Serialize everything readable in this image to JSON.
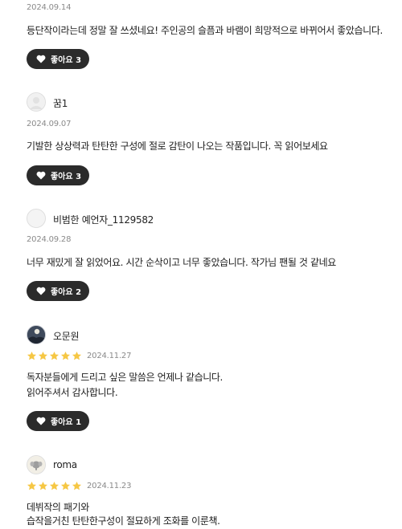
{
  "reviews": [
    {
      "user": "",
      "date": "2024.09.14",
      "lines": [
        "등단작이라는데 정말 잘 쓰셨네요! 주인공의 슬픔과 바램이 희망적으로 바뀌어서 좋았습니다."
      ],
      "like_label": "좋아요 3"
    },
    {
      "user": "꿈1",
      "date": "2024.09.07",
      "lines": [
        "기발한 상상력과 탄탄한 구성에 절로 감탄이 나오는 작품입니다. 꼭 읽어보세요"
      ],
      "like_label": "좋아요 3",
      "avatar_icon": "default-avatar-icon"
    },
    {
      "user": "비범한 예언자_1129582",
      "date": "2024.09.28",
      "lines": [
        "너무 재밌게 잘 읽었어요. 시간 순삭이고 너무 좋았습니다. 작가님 팬될 것 같네요"
      ],
      "like_label": "좋아요 2",
      "avatar_icon": "default-avatar-icon"
    },
    {
      "user": "오문원",
      "date": "2024.11.27",
      "rating": 5,
      "lines": [
        "독자분들에게 드리고 싶은 말씀은 언제나 같습니다.",
        "읽어주셔서 감사합니다."
      ],
      "like_label": "좋아요 1",
      "avatar_icon": "moon-landscape-avatar-icon"
    },
    {
      "user": "roma",
      "date": "2024.11.23",
      "rating": 5,
      "lines": [
        "데뷔작의  패기와",
        "습작을거친  탄탄한구성이  절묘하게  조화를 이룬책."
      ],
      "avatar_icon": "elephant-avatar-icon"
    }
  ],
  "colors": {
    "star": "#f6c744",
    "like_button_bg": "#2b2b2b",
    "date_text": "#8a8a8a"
  },
  "icons": {
    "like": "heart-icon",
    "star": "star-icon"
  }
}
